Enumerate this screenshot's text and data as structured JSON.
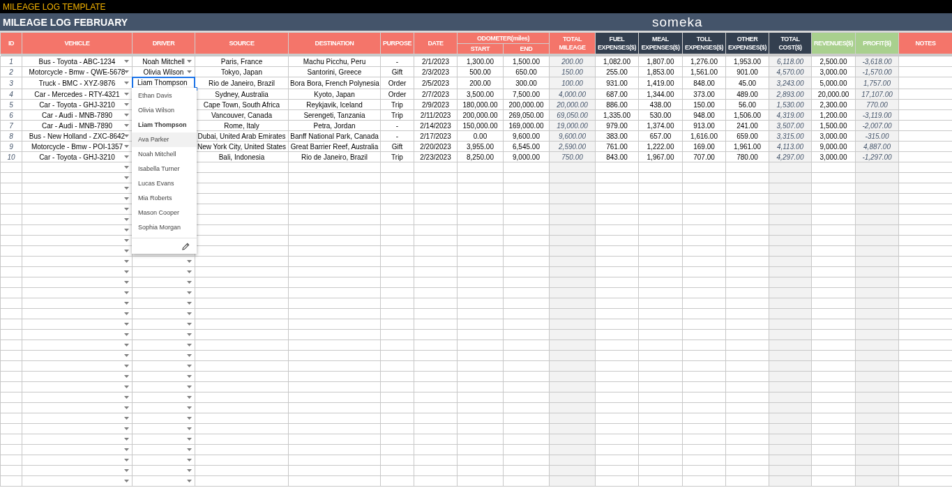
{
  "app_title": "MILEAGE LOG TEMPLATE",
  "sheet_title": "MILEAGE LOG FEBRUARY",
  "logo": "someka",
  "columns": [
    {
      "label": "ID",
      "color": "#f4756a",
      "kind": "index"
    },
    {
      "label": "VEHICLE",
      "color": "#f4756a",
      "kind": "dropdown"
    },
    {
      "label": "DRIVER",
      "color": "#f4756a",
      "kind": "dropdown"
    },
    {
      "label": "SOURCE",
      "color": "#f4756a",
      "kind": "text"
    },
    {
      "label": "DESTINATION",
      "color": "#f4756a",
      "kind": "text"
    },
    {
      "label": "PURPOSE",
      "color": "#f4756a",
      "kind": "text"
    },
    {
      "label": "DATE",
      "color": "#f4756a",
      "kind": "text"
    },
    {
      "label": "ODOMETER(miles)",
      "color": "#f4756a",
      "children": [
        {
          "label": "START",
          "kind": "text"
        },
        {
          "label": "END",
          "kind": "text"
        }
      ]
    },
    {
      "label": "TOTAL MILEAGE",
      "color": "#f4756a",
      "kind": "calculated"
    },
    {
      "label": "FUEL EXPENSES($)",
      "color": "#333f4f",
      "kind": "text"
    },
    {
      "label": "MEAL EXPENSES($)",
      "color": "#333f4f",
      "kind": "text"
    },
    {
      "label": "TOLL EXPENSES($)",
      "color": "#333f4f",
      "kind": "text"
    },
    {
      "label": "OTHER EXPENSES($)",
      "color": "#333f4f",
      "kind": "text"
    },
    {
      "label": "TOTAL COST($)",
      "color": "#333f4f",
      "kind": "calculated"
    },
    {
      "label": "REVENUES($)",
      "color": "#a9d08e",
      "kind": "text"
    },
    {
      "label": "PROFIT($)",
      "color": "#a9d08e",
      "kind": "calculated"
    },
    {
      "label": "NOTES",
      "color": "#f4756a",
      "kind": "text"
    }
  ],
  "rows": [
    {
      "id": "1",
      "vehicle": "Bus - Toyota - ABC-1234",
      "driver": "Noah Mitchell",
      "source": "Paris, France",
      "destination": "Machu Picchu, Peru",
      "purpose": "-",
      "date": "2/1/2023",
      "start": "1,300.00",
      "end": "1,500.00",
      "total_mileage": "200.00",
      "fuel": "1,082.00",
      "meal": "1,807.00",
      "toll": "1,276.00",
      "other": "1,953.00",
      "total_cost": "6,118.00",
      "revenues": "2,500.00",
      "profit": "-3,618.00"
    },
    {
      "id": "2",
      "vehicle": "Motorcycle - Bmw - QWE-5678",
      "driver": "Olivia Wilson",
      "source": "Tokyo, Japan",
      "destination": "Santorini, Greece",
      "purpose": "Gift",
      "date": "2/3/2023",
      "start": "500.00",
      "end": "650.00",
      "total_mileage": "150.00",
      "fuel": "255.00",
      "meal": "1,853.00",
      "toll": "1,561.00",
      "other": "901.00",
      "total_cost": "4,570.00",
      "revenues": "3,000.00",
      "profit": "-1,570.00"
    },
    {
      "id": "3",
      "vehicle": "Truck - BMC - XYZ-9876",
      "driver": "Liam Thompson",
      "active": true,
      "source": "Rio de Janeiro, Brazil",
      "destination": "Bora Bora, French Polynesia",
      "purpose": "Order",
      "date": "2/5/2023",
      "start": "200.00",
      "end": "300.00",
      "total_mileage": "100.00",
      "fuel": "931.00",
      "meal": "1,419.00",
      "toll": "848.00",
      "other": "45.00",
      "total_cost": "3,243.00",
      "revenues": "5,000.00",
      "profit": "1,757.00"
    },
    {
      "id": "4",
      "vehicle": "Car - Mercedes - RTY-4321",
      "source": "Sydney, Australia",
      "destination": "Kyoto, Japan",
      "purpose": "Order",
      "date": "2/7/2023",
      "start": "3,500.00",
      "end": "7,500.00",
      "total_mileage": "4,000.00",
      "fuel": "687.00",
      "meal": "1,344.00",
      "toll": "373.00",
      "other": "489.00",
      "total_cost": "2,893.00",
      "revenues": "20,000.00",
      "profit": "17,107.00"
    },
    {
      "id": "5",
      "vehicle": "Car - Toyota - GHJ-3210",
      "source": "Cape Town, South Africa",
      "destination": "Reykjavik, Iceland",
      "purpose": "Trip",
      "date": "2/9/2023",
      "start": "180,000.00",
      "end": "200,000.00",
      "total_mileage": "20,000.00",
      "fuel": "886.00",
      "meal": "438.00",
      "toll": "150.00",
      "other": "56.00",
      "total_cost": "1,530.00",
      "revenues": "2,300.00",
      "profit": "770.00"
    },
    {
      "id": "6",
      "vehicle": "Car - Audi - MNB-7890",
      "source": "Vancouver, Canada",
      "destination": "Serengeti, Tanzania",
      "purpose": "Trip",
      "date": "2/11/2023",
      "start": "200,000.00",
      "end": "269,050.00",
      "total_mileage": "69,050.00",
      "fuel": "1,335.00",
      "meal": "530.00",
      "toll": "948.00",
      "other": "1,506.00",
      "total_cost": "4,319.00",
      "revenues": "1,200.00",
      "profit": "-3,119.00"
    },
    {
      "id": "7",
      "vehicle": "Car - Audi - MNB-7890",
      "source": "Rome, Italy",
      "destination": "Petra, Jordan",
      "purpose": "-",
      "date": "2/14/2023",
      "start": "150,000.00",
      "end": "169,000.00",
      "total_mileage": "19,000.00",
      "fuel": "979.00",
      "meal": "1,374.00",
      "toll": "913.00",
      "other": "241.00",
      "total_cost": "3,507.00",
      "revenues": "1,500.00",
      "profit": "-2,007.00"
    },
    {
      "id": "8",
      "vehicle": "Bus - New Holland - ZXC-8642",
      "source": "Dubai, United Arab Emirates",
      "destination": "Banff National Park, Canada",
      "purpose": "-",
      "date": "2/17/2023",
      "start": "0.00",
      "end": "9,600.00",
      "total_mileage": "9,600.00",
      "fuel": "383.00",
      "meal": "657.00",
      "toll": "1,616.00",
      "other": "659.00",
      "total_cost": "3,315.00",
      "revenues": "3,000.00",
      "profit": "-315.00"
    },
    {
      "id": "9",
      "vehicle": "Motorcycle - Bmw - POI-1357",
      "source": "New York City, United States",
      "destination": "Great Barrier Reef, Australia",
      "purpose": "Gift",
      "date": "2/20/2023",
      "start": "3,955.00",
      "end": "6,545.00",
      "total_mileage": "2,590.00",
      "fuel": "761.00",
      "meal": "1,222.00",
      "toll": "169.00",
      "other": "1,961.00",
      "total_cost": "4,113.00",
      "revenues": "9,000.00",
      "profit": "4,887.00"
    },
    {
      "id": "10",
      "vehicle": "Car - Toyota - GHJ-3210",
      "source": "Bali, Indonesia",
      "destination": "Rio de Janeiro, Brazil",
      "purpose": "Trip",
      "date": "2/23/2023",
      "start": "8,250.00",
      "end": "9,000.00",
      "total_mileage": "750.00",
      "fuel": "843.00",
      "meal": "1,967.00",
      "toll": "707.00",
      "other": "780.00",
      "total_cost": "4,297.00",
      "revenues": "3,000.00",
      "profit": "-1,297.00"
    }
  ],
  "dropdown": {
    "items": [
      {
        "label": "Ethan Davis",
        "selected": false,
        "highlighted": false
      },
      {
        "label": "Olivia Wilson",
        "selected": false,
        "highlighted": false
      },
      {
        "label": "Liam Thompson",
        "selected": true,
        "highlighted": false
      },
      {
        "label": "Ava Parker",
        "selected": false,
        "highlighted": true
      },
      {
        "label": "Noah Mitchell",
        "selected": false,
        "highlighted": false
      },
      {
        "label": "Isabella Turner",
        "selected": false,
        "highlighted": false
      },
      {
        "label": "Lucas Evans",
        "selected": false,
        "highlighted": false
      },
      {
        "label": "Mia Roberts",
        "selected": false,
        "highlighted": false
      },
      {
        "label": "Mason Cooper",
        "selected": false,
        "highlighted": false
      },
      {
        "label": "Sophia Morgan",
        "selected": false,
        "highlighted": false
      }
    ]
  }
}
